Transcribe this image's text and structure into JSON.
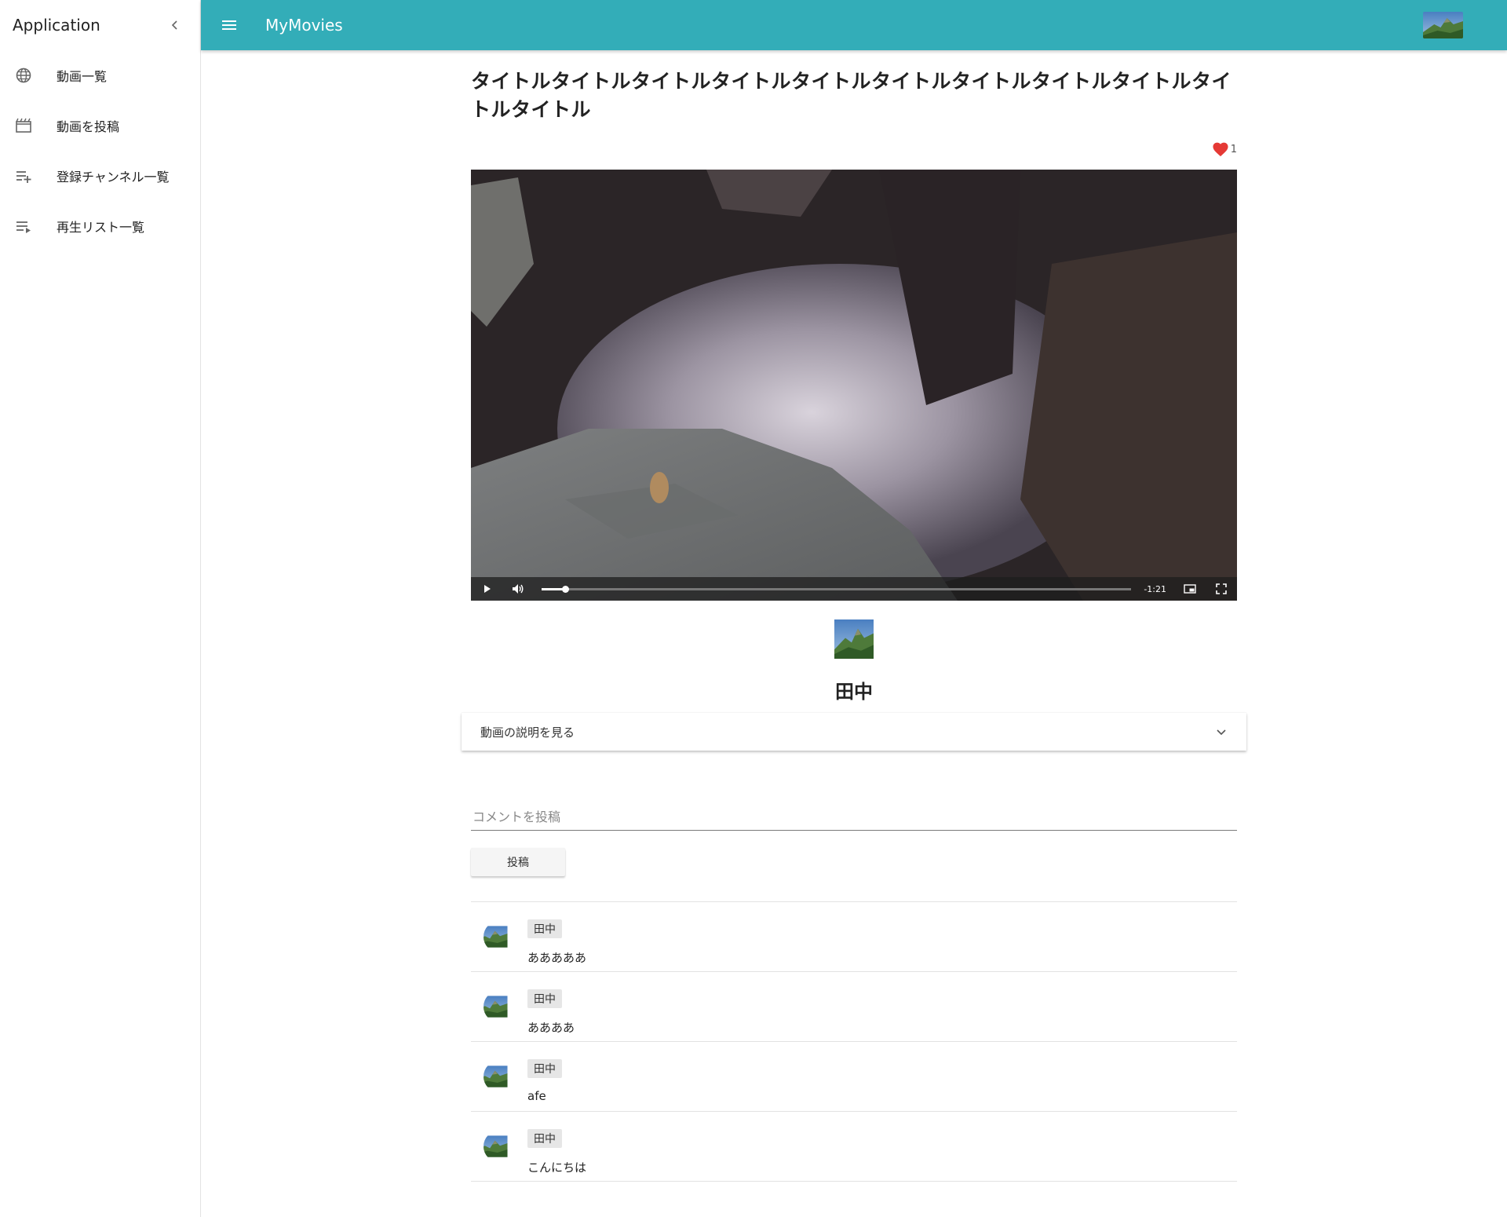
{
  "sidebar": {
    "title": "Application",
    "items": [
      {
        "icon": "globe-icon",
        "label": "動画一覧"
      },
      {
        "icon": "clapperboard-icon",
        "label": "動画を投稿"
      },
      {
        "icon": "playlist-add-icon",
        "label": "登録チャンネル一覧"
      },
      {
        "icon": "playlist-play-icon",
        "label": "再生リスト一覧"
      }
    ]
  },
  "topbar": {
    "app_name": "MyMovies"
  },
  "video": {
    "title": "タイトルタイトルタイトルタイトルタイトルタイトルタイトルタイトルタイトルタイトルタイトル",
    "like_count": "1",
    "time_remaining": "-1:21",
    "progress": 0.04
  },
  "channel": {
    "name": "田中"
  },
  "description": {
    "toggle_label": "動画の説明を見る"
  },
  "comment_form": {
    "placeholder": "コメントを投稿",
    "submit_label": "投稿"
  },
  "comments": [
    {
      "user": "田中",
      "text": "あああああ"
    },
    {
      "user": "田中",
      "text": "ああああ"
    },
    {
      "user": "田中",
      "text": "afe"
    },
    {
      "user": "田中",
      "text": "こんにちは"
    }
  ],
  "colors": {
    "accent": "#33adb8",
    "like": "#e53935"
  }
}
